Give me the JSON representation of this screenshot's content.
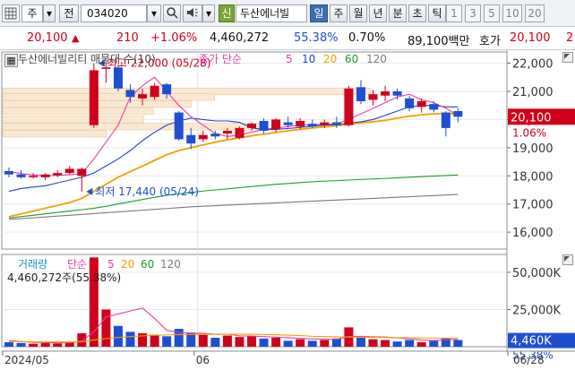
{
  "toolbar": {
    "market_type": "주",
    "code_label": "전",
    "stock_code": "034020",
    "credit_badge": "신",
    "stock_name": "두산에너빌",
    "periods": [
      "일",
      "주",
      "월",
      "년",
      "분",
      "초",
      "틱"
    ],
    "active_period": "일",
    "intervals": [
      "1",
      "3",
      "5",
      "10",
      "20"
    ]
  },
  "info": {
    "price": "20,100",
    "change": "210",
    "change_pct": "+1.06%",
    "volume": "4,460,272",
    "vol_ratio": "55.38%",
    "turnover": "0.70%",
    "amount": "89,100백만",
    "quote_label": "호가",
    "quote_price": "20,100",
    "quote_extra": "2",
    "colors": {
      "up": "#d0021b",
      "down": "#1f4fd1"
    }
  },
  "chart_data": {
    "type": "candlestick",
    "price_panel": {
      "title": "두산에너빌리티 매물대 수(10)",
      "ma_label_prefix": "종가 단순",
      "ma_periods": [
        "5",
        "10",
        "20",
        "60",
        "120"
      ],
      "ma_colors": [
        "#e83ea3",
        "#2344c7",
        "#f2a000",
        "#1d9b2a",
        "#7a7a7a"
      ],
      "y_ticks": [
        22000,
        21000,
        20000,
        19000,
        18000,
        17000,
        16000
      ],
      "y_tick_labels": [
        "22,000",
        "21,000",
        "20,000",
        "19,000",
        "18,000",
        "17,000",
        "16,000"
      ],
      "ylim": [
        15400,
        22400
      ],
      "current_price_label": "20,100",
      "current_pct_label": "1.06%",
      "high_marker": "최고 22,000 (05/28)",
      "low_marker": "최저 17,440 (05/24)",
      "candles": [
        {
          "o": 18170,
          "h": 18300,
          "l": 17950,
          "c": 18050
        },
        {
          "o": 18050,
          "h": 18200,
          "l": 17900,
          "c": 17950
        },
        {
          "o": 17950,
          "h": 18100,
          "l": 17900,
          "c": 18000
        },
        {
          "o": 17950,
          "h": 18100,
          "l": 17850,
          "c": 18050
        },
        {
          "o": 18020,
          "h": 18200,
          "l": 17950,
          "c": 18100
        },
        {
          "o": 18100,
          "h": 18350,
          "l": 18050,
          "c": 18250
        },
        {
          "o": 18000,
          "h": 18300,
          "l": 17440,
          "c": 18250
        },
        {
          "o": 19800,
          "h": 22000,
          "l": 19700,
          "c": 21750
        },
        {
          "o": 21800,
          "h": 22000,
          "l": 21300,
          "c": 21850
        },
        {
          "o": 21850,
          "h": 21950,
          "l": 21000,
          "c": 21100
        },
        {
          "o": 21050,
          "h": 21250,
          "l": 20600,
          "c": 20800
        },
        {
          "o": 20750,
          "h": 21100,
          "l": 20500,
          "c": 20900
        },
        {
          "o": 20800,
          "h": 21300,
          "l": 20700,
          "c": 21200
        },
        {
          "o": 21250,
          "h": 21300,
          "l": 20750,
          "c": 20900
        },
        {
          "o": 20250,
          "h": 20300,
          "l": 19250,
          "c": 19300
        },
        {
          "o": 19450,
          "h": 19700,
          "l": 18950,
          "c": 19150
        },
        {
          "o": 19300,
          "h": 19600,
          "l": 19200,
          "c": 19450
        },
        {
          "o": 19500,
          "h": 19600,
          "l": 19300,
          "c": 19400
        },
        {
          "o": 19500,
          "h": 19700,
          "l": 19300,
          "c": 19600
        },
        {
          "o": 19350,
          "h": 19750,
          "l": 19300,
          "c": 19700
        },
        {
          "o": 19700,
          "h": 19900,
          "l": 19600,
          "c": 19850
        },
        {
          "o": 19950,
          "h": 20050,
          "l": 19500,
          "c": 19600
        },
        {
          "o": 19650,
          "h": 20050,
          "l": 19550,
          "c": 20000
        },
        {
          "o": 19900,
          "h": 20100,
          "l": 19700,
          "c": 19800
        },
        {
          "o": 19750,
          "h": 20050,
          "l": 19650,
          "c": 19950
        },
        {
          "o": 19850,
          "h": 20000,
          "l": 19700,
          "c": 19750
        },
        {
          "o": 19800,
          "h": 20000,
          "l": 19700,
          "c": 19900
        },
        {
          "o": 19900,
          "h": 20100,
          "l": 19700,
          "c": 19800
        },
        {
          "o": 19800,
          "h": 21200,
          "l": 19750,
          "c": 21100
        },
        {
          "o": 21150,
          "h": 21400,
          "l": 20550,
          "c": 20650
        },
        {
          "o": 20700,
          "h": 21050,
          "l": 20500,
          "c": 20900
        },
        {
          "o": 20850,
          "h": 21200,
          "l": 20650,
          "c": 21000
        },
        {
          "o": 21000,
          "h": 21100,
          "l": 20700,
          "c": 20850
        },
        {
          "o": 20750,
          "h": 20850,
          "l": 20300,
          "c": 20400
        },
        {
          "o": 20450,
          "h": 20750,
          "l": 20250,
          "c": 20650
        },
        {
          "o": 20550,
          "h": 20650,
          "l": 20250,
          "c": 20350
        },
        {
          "o": 20250,
          "h": 20300,
          "l": 19400,
          "c": 19700
        },
        {
          "o": 20300,
          "h": 20400,
          "l": 19900,
          "c": 20100
        }
      ],
      "ma5": [
        18150,
        18080,
        18030,
        18000,
        18020,
        18040,
        18080,
        18600,
        19200,
        19800,
        20800,
        21200,
        21500,
        21000,
        20500,
        20100,
        19800,
        19500,
        19400,
        19450,
        19550,
        19650,
        19700,
        19750,
        19800,
        19820,
        19830,
        19850,
        20000,
        20200,
        20400,
        20600,
        20800,
        20900,
        20700,
        20600,
        20400,
        20150
      ],
      "ma10": [
        17450,
        17550,
        17600,
        17650,
        17750,
        17850,
        17950,
        18100,
        18350,
        18600,
        18900,
        19250,
        19550,
        19800,
        19950,
        20050,
        20000,
        19950,
        19950,
        19900,
        19700,
        19650,
        19650,
        19680,
        19720,
        19760,
        19800,
        19820,
        19870,
        19920,
        20000,
        20150,
        20300,
        20450,
        20500,
        20500,
        20450,
        20450
      ],
      "ma20": [
        16550,
        16650,
        16750,
        16850,
        16950,
        17050,
        17200,
        17450,
        17700,
        17950,
        18150,
        18350,
        18550,
        18750,
        18900,
        19000,
        19100,
        19200,
        19280,
        19350,
        19420,
        19480,
        19540,
        19600,
        19650,
        19700,
        19740,
        19780,
        19830,
        19880,
        19920,
        19970,
        20050,
        20120,
        20170,
        20200,
        20220,
        20200
      ],
      "ma60": [
        16500,
        16550,
        16600,
        16650,
        16700,
        16750,
        16800,
        16850,
        16920,
        17000,
        17080,
        17160,
        17240,
        17310,
        17360,
        17410,
        17460,
        17500,
        17540,
        17580,
        17620,
        17660,
        17700,
        17730,
        17760,
        17790,
        17810,
        17830,
        17850,
        17870,
        17890,
        17910,
        17930,
        17950,
        17970,
        17990,
        18010,
        18030
      ],
      "ma120": [
        16450,
        16480,
        16510,
        16540,
        16570,
        16600,
        16630,
        16660,
        16690,
        16720,
        16750,
        16780,
        16810,
        16840,
        16870,
        16900,
        16920,
        16940,
        16960,
        16980,
        17000,
        17020,
        17040,
        17060,
        17080,
        17100,
        17120,
        17140,
        17160,
        17180,
        17200,
        17220,
        17240,
        17260,
        17280,
        17300,
        17320,
        17340
      ],
      "profile_rows": [
        {
          "price": 21000,
          "width": 0.78
        },
        {
          "price": 20800,
          "width": 0.45
        },
        {
          "price": 20550,
          "width": 0.4
        },
        {
          "price": 20300,
          "width": 0.32
        },
        {
          "price": 20000,
          "width": 0.3
        },
        {
          "price": 19750,
          "width": 0.55
        },
        {
          "price": 19500,
          "width": 0.22
        }
      ]
    },
    "volume_panel": {
      "title_prefix": "거래량",
      "ma_label_prefix": "단순",
      "ma_periods": [
        "5",
        "20",
        "60",
        "120"
      ],
      "ma_colors": [
        "#e83ea3",
        "#f2a000",
        "#1d9b2a",
        "#7a7a7a"
      ],
      "value_label": "4,460,272주(55.38%)",
      "y_ticks": [
        50000,
        25000
      ],
      "y_tick_labels": [
        "50,000K",
        "25,000K"
      ],
      "ylim": [
        0,
        62000
      ],
      "current_label": "4,460K",
      "current_pct_label": "55.38%",
      "volumes": [
        3000,
        2500,
        2000,
        2500,
        2200,
        2800,
        9000,
        60000,
        25000,
        14000,
        10000,
        9000,
        8000,
        7000,
        12000,
        9000,
        8000,
        6000,
        7500,
        6500,
        7000,
        5500,
        6000,
        4000,
        5000,
        4000,
        4500,
        5500,
        13000,
        6000,
        5000,
        4500,
        3500,
        4500,
        3000,
        4000,
        6000,
        4460
      ],
      "ma5_vol": [
        4000,
        3500,
        3000,
        2800,
        2600,
        2700,
        3800,
        10000,
        20000,
        22000,
        24000,
        26000,
        19000,
        11000,
        9500,
        9200,
        9000,
        8300,
        8500,
        7300,
        7200,
        6800,
        6400,
        6000,
        5600,
        5200,
        5000,
        5000,
        6800,
        7000,
        6700,
        6500,
        6000,
        5200,
        4500,
        4200,
        4700,
        4800
      ],
      "ma20_vol": [
        3500,
        3400,
        3300,
        3200,
        3200,
        3200,
        3400,
        4500,
        5500,
        6200,
        6800,
        7300,
        7700,
        7900,
        8100,
        8200,
        8300,
        8300,
        8400,
        8400,
        8400,
        8200,
        8000,
        7800,
        7500,
        7000,
        6800,
        6600,
        6500,
        6400,
        6300,
        6200,
        6100,
        6000,
        5900,
        5800,
        5800,
        5700
      ]
    },
    "x_labels": [
      {
        "text": "2024/05",
        "index": 0
      },
      {
        "text": "06",
        "index": 16
      },
      {
        "text": "06/28",
        "index": 37
      }
    ]
  }
}
